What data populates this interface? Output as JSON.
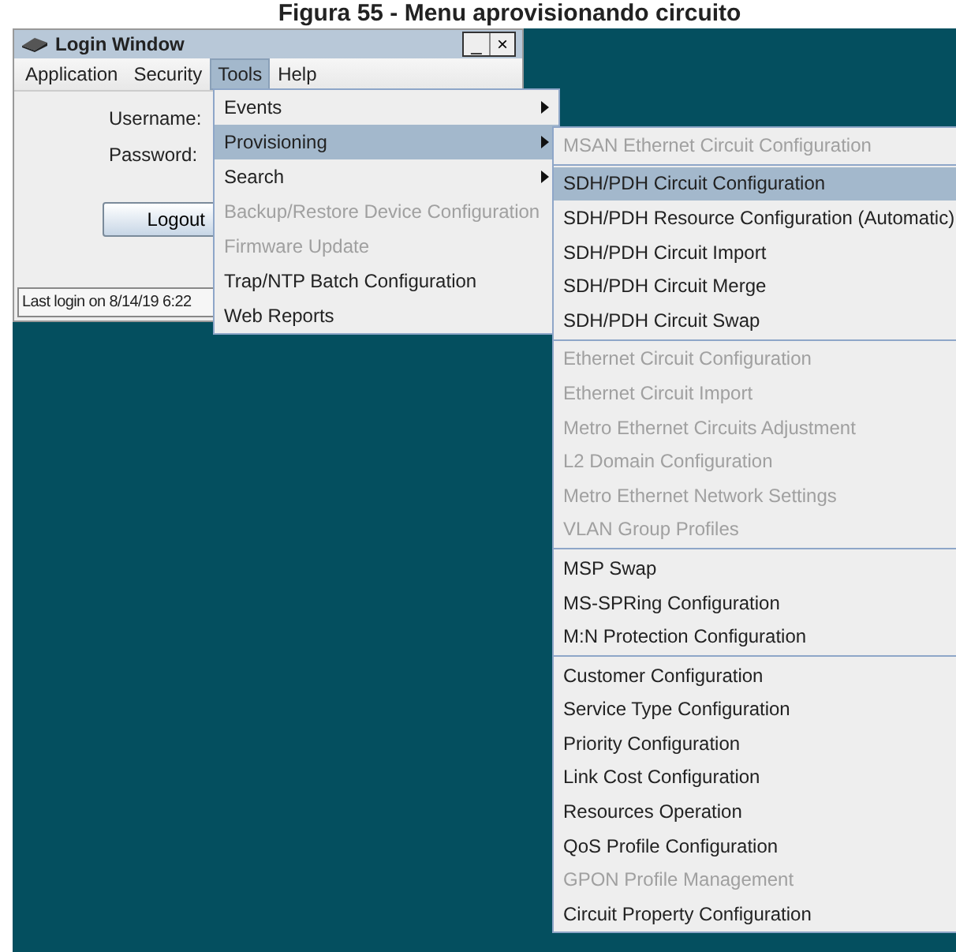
{
  "caption": "Figura 55 - Menu aprovisionando circuito",
  "window": {
    "title": "Login Window",
    "minimize": "_",
    "close": "×"
  },
  "menubar": [
    {
      "label": "Application",
      "selected": false
    },
    {
      "label": "Security",
      "selected": false
    },
    {
      "label": "Tools",
      "selected": true
    },
    {
      "label": "Help",
      "selected": false
    }
  ],
  "form": {
    "username_label": "Username:",
    "password_label": "Password:",
    "logout": "Logout"
  },
  "status_bar": "Last login on 8/14/19 6:22",
  "tools_menu": [
    {
      "label": "Events",
      "disabled": false,
      "selected": false,
      "submenu": true
    },
    {
      "label": "Provisioning",
      "disabled": false,
      "selected": true,
      "submenu": true
    },
    {
      "label": "Search",
      "disabled": false,
      "selected": false,
      "submenu": true
    },
    {
      "label": "Backup/Restore Device Configuration",
      "disabled": true,
      "selected": false,
      "submenu": false
    },
    {
      "label": "Firmware Update",
      "disabled": true,
      "selected": false,
      "submenu": false
    },
    {
      "label": "Trap/NTP Batch Configuration",
      "disabled": false,
      "selected": false,
      "submenu": false
    },
    {
      "label": "Web Reports",
      "disabled": false,
      "selected": false,
      "submenu": false
    }
  ],
  "provisioning_menu": [
    {
      "kind": "item",
      "label": "MSAN Ethernet Circuit Configuration",
      "disabled": true,
      "selected": false
    },
    {
      "kind": "separator"
    },
    {
      "kind": "item",
      "label": "SDH/PDH Circuit Configuration",
      "disabled": false,
      "selected": true
    },
    {
      "kind": "item",
      "label": "SDH/PDH Resource Configuration (Automatic)",
      "disabled": false,
      "selected": false
    },
    {
      "kind": "item",
      "label": "SDH/PDH Circuit Import",
      "disabled": false,
      "selected": false
    },
    {
      "kind": "item",
      "label": "SDH/PDH Circuit Merge",
      "disabled": false,
      "selected": false
    },
    {
      "kind": "item",
      "label": "SDH/PDH Circuit Swap",
      "disabled": false,
      "selected": false
    },
    {
      "kind": "separator"
    },
    {
      "kind": "item",
      "label": "Ethernet Circuit Configuration",
      "disabled": true,
      "selected": false
    },
    {
      "kind": "item",
      "label": "Ethernet Circuit Import",
      "disabled": true,
      "selected": false
    },
    {
      "kind": "item",
      "label": "Metro Ethernet Circuits Adjustment",
      "disabled": true,
      "selected": false
    },
    {
      "kind": "item",
      "label": "L2 Domain Configuration",
      "disabled": true,
      "selected": false
    },
    {
      "kind": "item",
      "label": "Metro Ethernet Network Settings",
      "disabled": true,
      "selected": false
    },
    {
      "kind": "item",
      "label": "VLAN Group Profiles",
      "disabled": true,
      "selected": false
    },
    {
      "kind": "separator"
    },
    {
      "kind": "item",
      "label": "MSP Swap",
      "disabled": false,
      "selected": false
    },
    {
      "kind": "item",
      "label": "MS-SPRing Configuration",
      "disabled": false,
      "selected": false
    },
    {
      "kind": "item",
      "label": "M:N Protection Configuration",
      "disabled": false,
      "selected": false
    },
    {
      "kind": "separator"
    },
    {
      "kind": "item",
      "label": "Customer Configuration",
      "disabled": false,
      "selected": false
    },
    {
      "kind": "item",
      "label": "Service Type Configuration",
      "disabled": false,
      "selected": false
    },
    {
      "kind": "item",
      "label": "Priority Configuration",
      "disabled": false,
      "selected": false
    },
    {
      "kind": "item",
      "label": "Link Cost Configuration",
      "disabled": false,
      "selected": false
    },
    {
      "kind": "item",
      "label": "Resources Operation",
      "disabled": false,
      "selected": false
    },
    {
      "kind": "item",
      "label": "QoS Profile Configuration",
      "disabled": false,
      "selected": false
    },
    {
      "kind": "item",
      "label": "GPON Profile Management",
      "disabled": true,
      "selected": false
    },
    {
      "kind": "item",
      "label": "Circuit Property Configuration",
      "disabled": false,
      "selected": false
    }
  ]
}
